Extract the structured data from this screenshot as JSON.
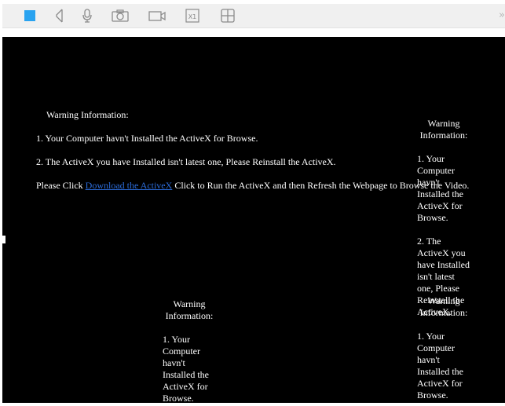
{
  "toolbar": {
    "buttons": [
      {
        "name": "stop-square-icon",
        "color": "#29a3f0"
      },
      {
        "name": "volume-icon"
      },
      {
        "name": "microphone-icon"
      },
      {
        "name": "camera-icon"
      },
      {
        "name": "record-video-icon"
      },
      {
        "name": "zoom-x1-icon",
        "label": "X1"
      },
      {
        "name": "grid-layout-icon"
      }
    ],
    "expand_label": "»"
  },
  "warning": {
    "title": "Warning Information:",
    "line1": "1. Your Computer havn't Installed the ActiveX for Browse.",
    "line2": "2. The ActiveX you have Installed isn't latest one, Please Reinstall the ActiveX.",
    "line3_prefix": "Please Click ",
    "line3_link": "Download the ActiveX",
    "line3_suffix": " Click to Run the ActiveX and then Refresh the Webpage to Browse the Video."
  },
  "warning_narrow": {
    "title": "Warning Information:",
    "line1": "1. Your Computer havn't Installed the ActiveX for Browse.",
    "line2": "2. The ActiveX you have Installed isn't latest one, Please Reinstall the ActiveX."
  }
}
